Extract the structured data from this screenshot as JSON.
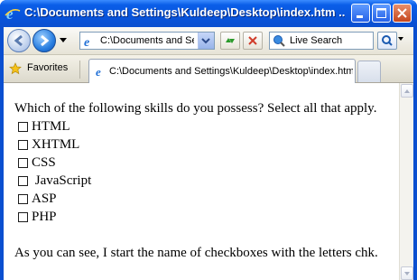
{
  "window": {
    "title": "C:\\Documents and Settings\\Kuldeep\\Desktop\\index.htm ...",
    "controls": [
      "minimize",
      "maximize",
      "close"
    ]
  },
  "toolbar": {
    "address_value": "C:\\Documents and Set",
    "search_placeholder": "Live Search"
  },
  "tabbar": {
    "favorites_label": "Favorites",
    "active_tab_title": "C:\\Documents and Settings\\Kuldeep\\Desktop\\index.htm"
  },
  "page": {
    "question": "Which of the following skills do you possess? Select all that apply.",
    "options": [
      "HTML",
      "XHTML",
      "CSS",
      " JavaScript",
      "ASP",
      "PHP"
    ],
    "note": "As you can see, I start the name of checkboxes with the letters chk."
  },
  "colors": {
    "titlebar": "#0a5ee8",
    "chrome": "#ece9d8"
  }
}
